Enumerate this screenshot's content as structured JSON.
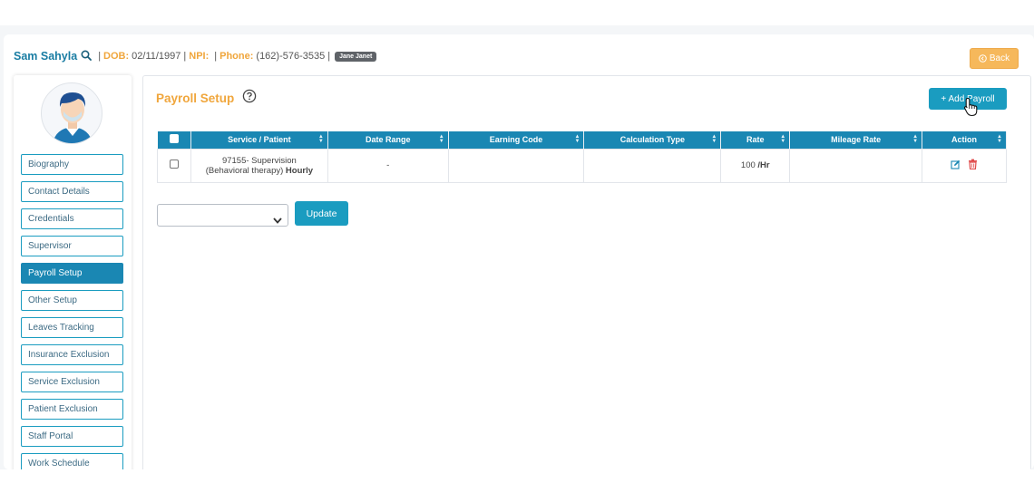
{
  "header": {
    "patient_name": "Sam Sahyla",
    "dob_label": "DOB:",
    "dob_value": "02/11/1997",
    "npi_label": "NPI:",
    "phone_label": "Phone:",
    "phone_value": "(162)-576-3535",
    "tag": "Jane Janet",
    "back_label": "Back"
  },
  "sidebar": {
    "items": [
      {
        "label": "Biography"
      },
      {
        "label": "Contact Details"
      },
      {
        "label": "Credentials"
      },
      {
        "label": "Supervisor"
      },
      {
        "label": "Payroll Setup",
        "active": true
      },
      {
        "label": "Other Setup"
      },
      {
        "label": "Leaves Tracking"
      },
      {
        "label": "Insurance Exclusion"
      },
      {
        "label": "Service Exclusion"
      },
      {
        "label": "Patient Exclusion"
      },
      {
        "label": "Staff Portal"
      },
      {
        "label": "Work Schedule"
      }
    ]
  },
  "main": {
    "title": "Payroll Setup",
    "add_button": "+ Add Payroll",
    "update_button": "Update"
  },
  "table": {
    "headers": [
      "Service / Patient",
      "Date Range",
      "Earning Code",
      "Calculation Type",
      "Rate",
      "Mileage Rate",
      "Action"
    ],
    "rows": [
      {
        "service_line1": "97155- Supervision",
        "service_line2": "(Behavioral therapy)",
        "service_type": "Hourly",
        "date_range": "-",
        "earning_code": "",
        "calculation_type": "",
        "rate_value": "100",
        "rate_unit": "/Hr",
        "mileage_rate": ""
      }
    ]
  },
  "colors": {
    "accent": "#1a87b3",
    "button": "#1a9cc0",
    "orange": "#f0a63c",
    "back": "#f6b85b",
    "delete": "#e04b4b"
  }
}
